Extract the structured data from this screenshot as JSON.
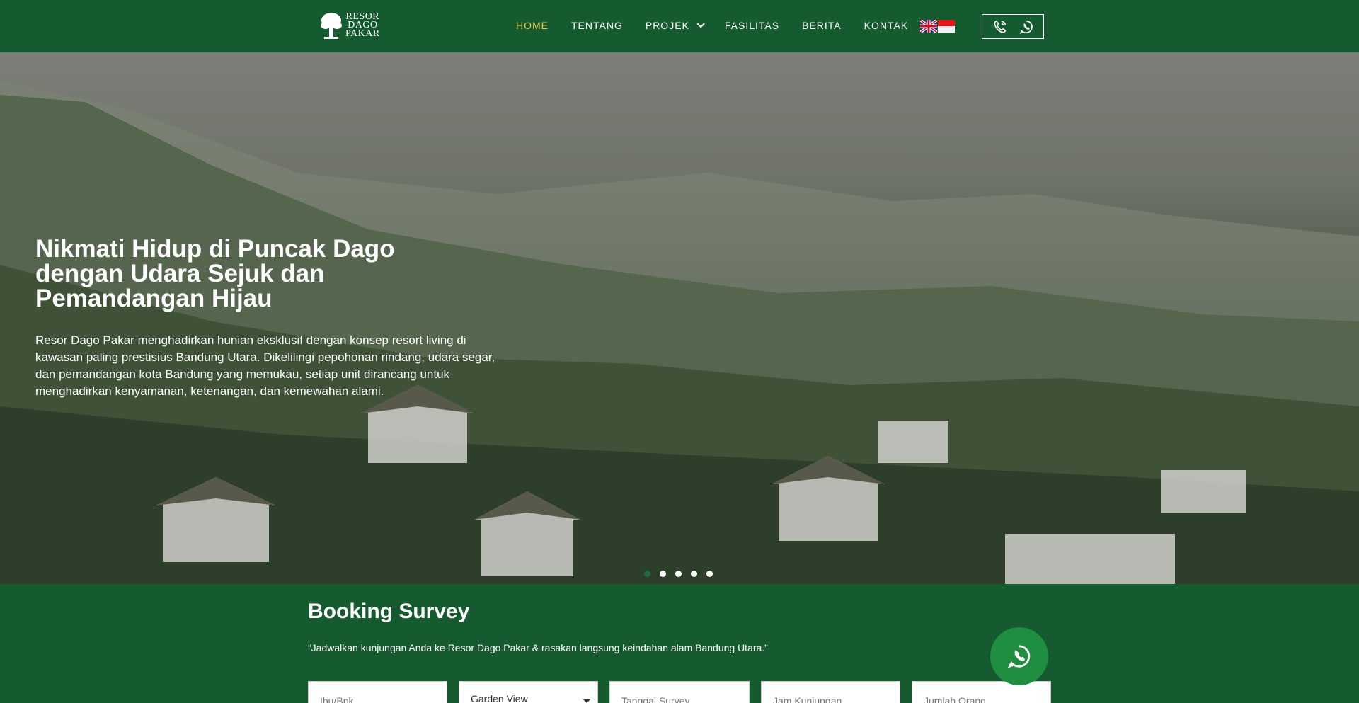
{
  "brand": {
    "logo_lines": [
      "RESOR",
      "DAGO",
      "PAKAR"
    ]
  },
  "nav": {
    "items": [
      {
        "label": "HOME"
      },
      {
        "label": "TENTANG"
      },
      {
        "label": "PROJEK"
      },
      {
        "label": "FASILITAS"
      },
      {
        "label": "BERITA"
      },
      {
        "label": "KONTAK"
      }
    ],
    "active": "HOME"
  },
  "hero": {
    "title": "Nikmati Hidup di Puncak Dago dengan Udara Sejuk dan Pemandangan Hijau",
    "description": "Resor Dago Pakar menghadirkan hunian eksklusif dengan konsep resort living di kawasan paling prestisius Bandung Utara. Dikelilingi pepohonan rindang, udara segar, dan pemandangan kota Bandung yang memukau, setiap unit dirancang untuk menghadirkan kenyamanan, ketenangan, dan kemewahan alami.",
    "slides_total": 5,
    "active_slide": 1
  },
  "booking": {
    "title": "Booking Survey",
    "subtitle": "“Jadwalkan kunjungan Anda ke Resor Dago Pakar & rasakan langsung keindahan alam Bandung Utara.”",
    "name_placeholder": "Ibu/Bpk..",
    "unit_selected": "Garden View",
    "date_placeholder": "Tanggal Survey",
    "time_placeholder": "Jam Kunjungan",
    "people_placeholder": "Jumlah Orang"
  },
  "colors": {
    "primary_green": "#165a30",
    "accent_gold": "#e6c84a",
    "whatsapp_green": "#1f8e41"
  },
  "icons": [
    "tree-logo-icon",
    "uk-flag-icon",
    "indonesia-flag-icon",
    "phone-icon",
    "whatsapp-icon",
    "chevron-down-icon"
  ]
}
